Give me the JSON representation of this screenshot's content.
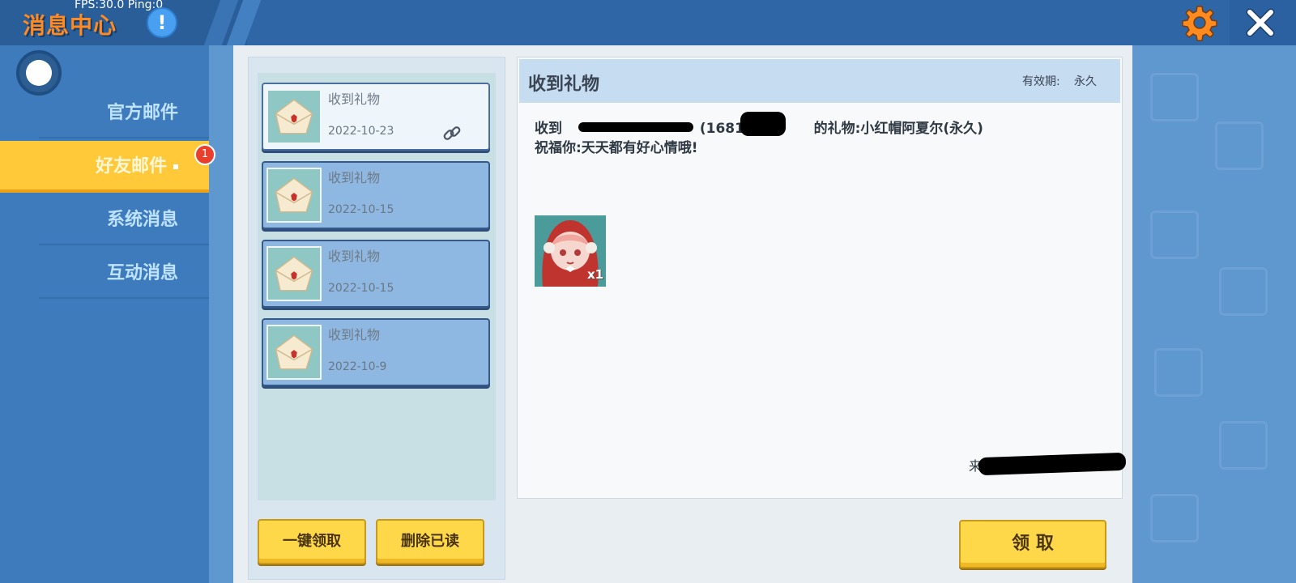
{
  "header": {
    "title": "消息中心",
    "fps_text": "FPS:30.0  Ping:0",
    "info_icon": "!",
    "colors": {
      "title": "#ff8a1f",
      "bar": "#2e66a6"
    }
  },
  "sidebar": {
    "items": [
      {
        "label": "官方邮件",
        "active": false
      },
      {
        "label": "好友邮件",
        "active": true,
        "badge": "1"
      },
      {
        "label": "系统消息",
        "active": false
      },
      {
        "label": "互动消息",
        "active": false
      }
    ]
  },
  "mail_list": {
    "items": [
      {
        "title": "收到礼物",
        "date": "2022-10-23",
        "selected": true,
        "attachment": true
      },
      {
        "title": "收到礼物",
        "date": "2022-10-15",
        "selected": false
      },
      {
        "title": "收到礼物",
        "date": "2022-10-15",
        "selected": false
      },
      {
        "title": "收到礼物",
        "date": "2022-10-9",
        "selected": false
      }
    ],
    "buttons": {
      "claim_all": "一键领取",
      "delete_read": "删除已读"
    }
  },
  "detail": {
    "title": "收到礼物",
    "validity_label": "有效期:",
    "validity_value": "永久",
    "line1_prefix": "收到",
    "line1_id_fragment": "(16816",
    "line1_suffix": "的礼物:小红帽阿夏尔(永久)",
    "line2": "祝福你:天天都有好心情哦!",
    "gift_quantity": "x1",
    "from_prefix": "来",
    "claim_button": "领 取"
  }
}
